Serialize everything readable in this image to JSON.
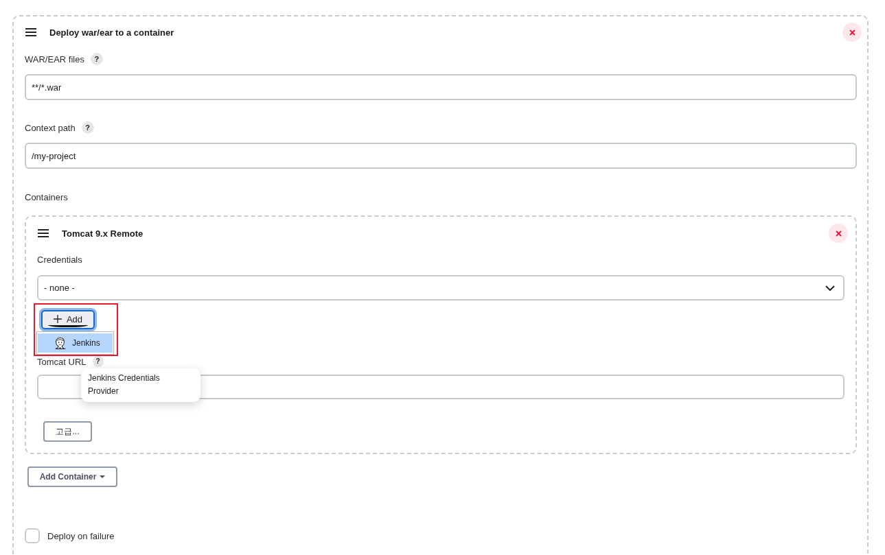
{
  "section": {
    "title": "Deploy war/ear to a container",
    "fields": [
      {
        "label": "WAR/EAR files",
        "help": "?",
        "value": "**/*.war"
      },
      {
        "label": "Context path",
        "help": "?",
        "value": "/my-project"
      }
    ],
    "containers": {
      "label": "Containers",
      "items": [
        {
          "title": "Tomcat 9.x Remote",
          "fields": [
            {
              "kind": "select",
              "label": "Credentials",
              "value": "- none -"
            },
            {
              "kind": "add",
              "button": "Add",
              "focused": true,
              "highlighted": true,
              "menu": {
                "items": [
                  {
                    "label": "Jenkins",
                    "selected": true
                  }
                ],
                "tooltip": "Jenkins Credentials Provider"
              }
            },
            {
              "kind": "text",
              "label": "Tomcat URL",
              "help": "?"
            }
          ],
          "advanced_button": "고급..."
        }
      ],
      "add_button": "Add Container"
    },
    "options": [
      {
        "label": "Deploy on failure",
        "checked": false
      }
    ]
  }
}
